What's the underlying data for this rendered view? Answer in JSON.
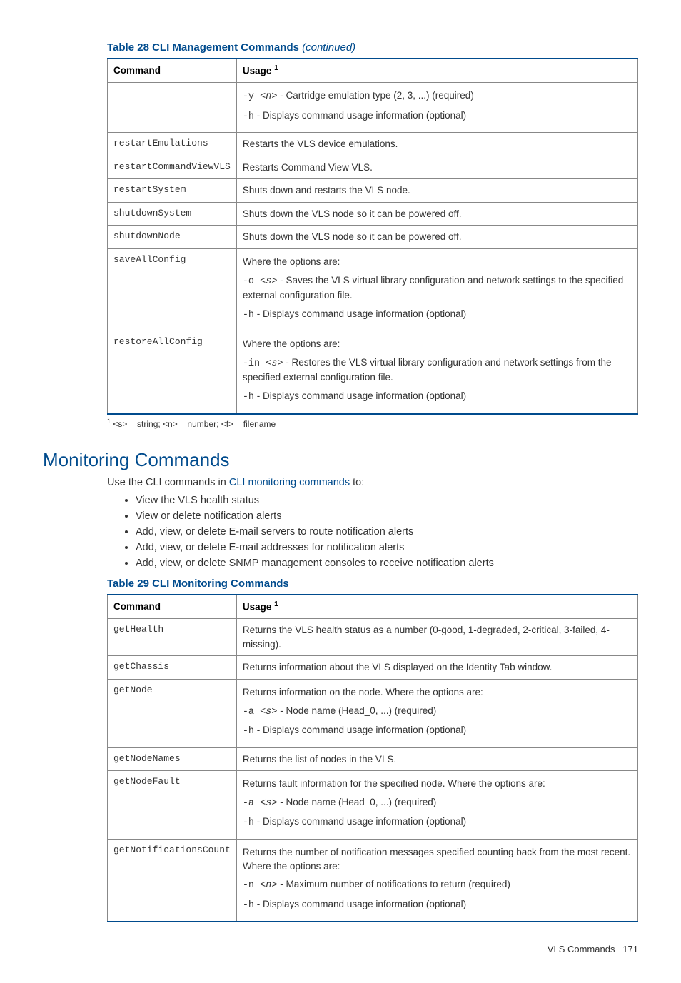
{
  "table28": {
    "caption_prefix": "Table 28 CLI Management Commands",
    "caption_suffix": "(continued)",
    "head": {
      "col1": "Command",
      "col2": "Usage",
      "sup": "1"
    },
    "rows": [
      {
        "cmd": "",
        "lines": [
          {
            "pre": "-y ",
            "arg": "<n>",
            "post": " - Cartridge emulation type (2, 3, ...) (required)"
          },
          {
            "pre": "-h",
            "arg": "",
            "post": " - Displays command usage information (optional)"
          }
        ]
      },
      {
        "cmd": "restartEmulations",
        "plain": "Restarts the VLS device emulations."
      },
      {
        "cmd": "restartCommandViewVLS",
        "plain": "Restarts Command View VLS."
      },
      {
        "cmd": "restartSystem",
        "plain": "Shuts down and restarts the VLS node."
      },
      {
        "cmd": "shutdownSystem",
        "plain": "Shuts down the VLS node so it can be powered off."
      },
      {
        "cmd": "shutdownNode",
        "plain": "Shuts down the VLS node so it can be powered off."
      },
      {
        "cmd": "saveAllConfig",
        "lead": "Where the options are:",
        "lines": [
          {
            "pre": "-o ",
            "arg": "<s>",
            "post": " - Saves the VLS virtual library configuration and network settings to the specified external configuration file."
          },
          {
            "pre": "-h",
            "arg": "",
            "post": " - Displays command usage information (optional)"
          }
        ]
      },
      {
        "cmd": "restoreAllConfig",
        "lead": "Where the options are:",
        "lines": [
          {
            "pre": "-in ",
            "arg": "<s>",
            "post": " - Restores the VLS virtual library configuration and network settings from the specified external configuration file."
          },
          {
            "pre": "-h",
            "arg": "",
            "post": " - Displays command usage information (optional)"
          }
        ]
      }
    ],
    "footnote_sup": "1",
    "footnote": "  <s> = string; <n> = number; <f> = filename"
  },
  "monitoring": {
    "heading": "Monitoring Commands",
    "intro_pre": "Use the CLI commands in ",
    "intro_link": "CLI monitoring commands",
    "intro_post": " to:",
    "bullets": [
      "View the VLS health status",
      "View or delete notification alerts",
      "Add, view, or delete E-mail servers to route notification alerts",
      "Add, view, or delete E-mail addresses for notification alerts",
      "Add, view, or delete SNMP management consoles to receive notification alerts"
    ]
  },
  "table29": {
    "caption": "Table 29 CLI Monitoring Commands",
    "head": {
      "col1": "Command",
      "col2": "Usage",
      "sup": "1"
    },
    "rows": [
      {
        "cmd": "getHealth",
        "plain": "Returns the VLS health status as a number (0-good, 1-degraded, 2-critical, 3-failed, 4-missing)."
      },
      {
        "cmd": "getChassis",
        "plain": "Returns information about the VLS displayed on the Identity Tab window."
      },
      {
        "cmd": "getNode",
        "lead": "Returns information on the node. Where the options are:",
        "lines": [
          {
            "pre": "-a ",
            "arg": "<s>",
            "post": " - Node name (Head_0, ...) (required)"
          },
          {
            "pre": "-h",
            "arg": "",
            "post": " - Displays command usage information (optional)"
          }
        ]
      },
      {
        "cmd": "getNodeNames",
        "plain": "Returns the list of nodes in the VLS."
      },
      {
        "cmd": "getNodeFault",
        "lead": "Returns fault information for the specified node. Where the options are:",
        "lines": [
          {
            "pre": "-a ",
            "arg": "<s>",
            "post": " - Node name (Head_0, ...) (required)"
          },
          {
            "pre": "-h",
            "arg": "",
            "post": " - Displays command usage information (optional)"
          }
        ]
      },
      {
        "cmd": "getNotificationsCount",
        "lead": "Returns the number of notification messages specified counting back from the most recent. Where the options are:",
        "lines": [
          {
            "pre": "-n ",
            "arg": "<n>",
            "post": " - Maximum number of notifications to return (required)"
          },
          {
            "pre": "-h",
            "arg": "",
            "post": " - Displays command usage information (optional)"
          }
        ]
      }
    ]
  },
  "footer": {
    "label": "VLS Commands",
    "page": "171"
  }
}
